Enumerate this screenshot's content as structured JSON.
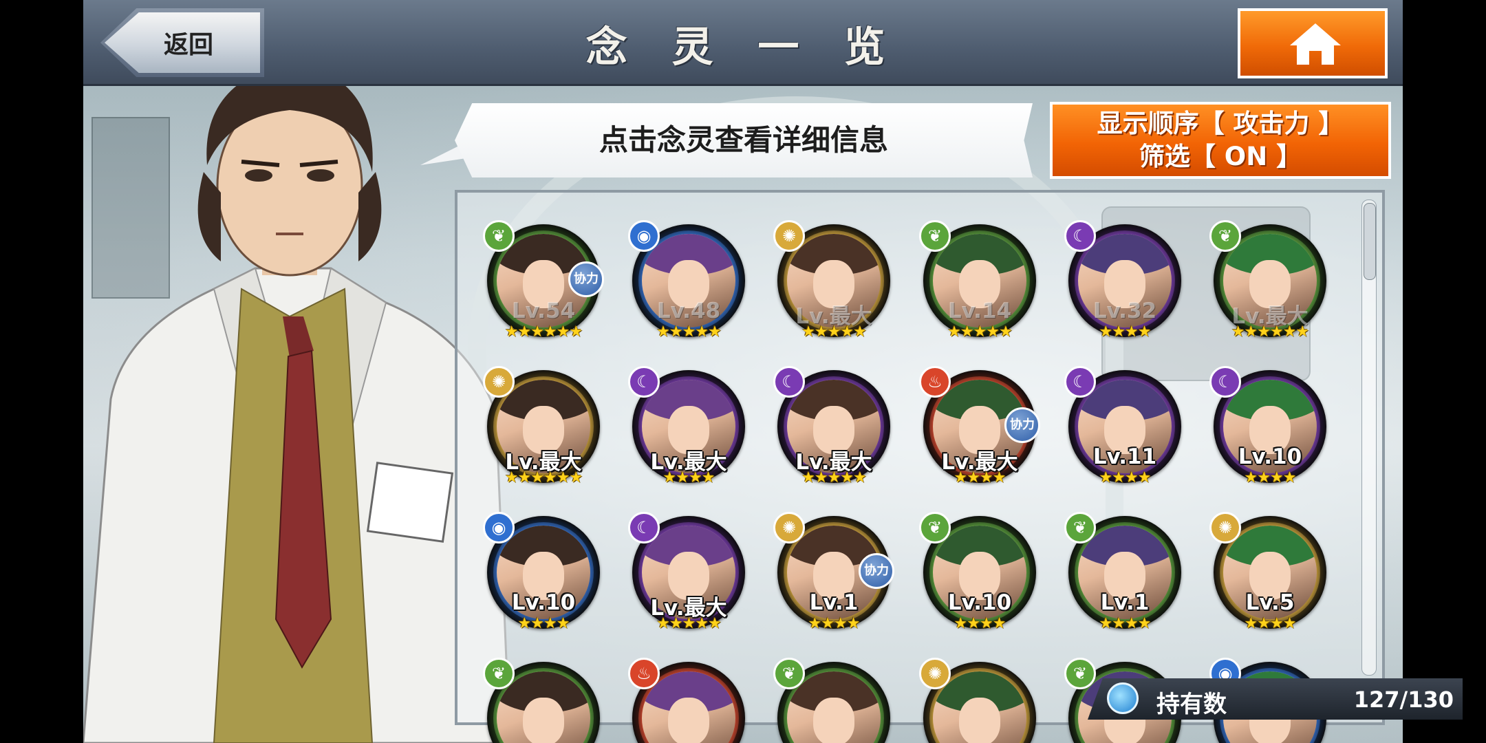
{
  "header": {
    "title": "念 灵 一 览",
    "back_label": "返回"
  },
  "hint": "点击念灵查看详细信息",
  "sort": {
    "order_label": "显示顺序【 攻击力 】",
    "filter_label": "筛选【 ON 】"
  },
  "element_icons": {
    "wood": "leaf-icon",
    "water": "water-drop-icon",
    "light": "light-burst-icon",
    "dark": "crescent-moon-icon",
    "fire": "flame-icon"
  },
  "element_colors": {
    "wood": "#5ba53b",
    "water": "#2f6fd0",
    "light": "#d8a93a",
    "dark": "#7a3bb3",
    "fire": "#d9452a"
  },
  "rows": [
    [
      {
        "element": "wood",
        "level": "Lv.54",
        "stars": "★★★★★★",
        "coop": true,
        "dim": true
      },
      {
        "element": "water",
        "level": "Lv.48",
        "stars": "★★★★★",
        "coop": false,
        "dim": true
      },
      {
        "element": "light",
        "level": "Lv.最大",
        "stars": "★★★★★",
        "coop": false,
        "dim": true
      },
      {
        "element": "wood",
        "level": "Lv.14",
        "stars": "★★★★★",
        "coop": false,
        "dim": true
      },
      {
        "element": "dark",
        "level": "Lv.32",
        "stars": "★★★★",
        "coop": false,
        "dim": true
      },
      {
        "element": "wood",
        "level": "Lv.最大",
        "stars": "★★★★★★",
        "coop": false,
        "dim": true
      }
    ],
    [
      {
        "element": "light",
        "level": "Lv.最大",
        "stars": "★★★★★★",
        "coop": false,
        "dim": false
      },
      {
        "element": "dark",
        "level": "Lv.最大",
        "stars": "★★★★",
        "coop": false,
        "dim": false
      },
      {
        "element": "dark",
        "level": "Lv.最大",
        "stars": "★★★★★",
        "coop": false,
        "dim": false
      },
      {
        "element": "fire",
        "level": "Lv.最大",
        "stars": "★★★★",
        "coop": true,
        "dim": false
      },
      {
        "element": "dark",
        "level": "Lv.11",
        "stars": "★★★★",
        "coop": false,
        "dim": false
      },
      {
        "element": "dark",
        "level": "Lv.10",
        "stars": "★★★★",
        "coop": false,
        "dim": false
      }
    ],
    [
      {
        "element": "water",
        "level": "Lv.10",
        "stars": "★★★★",
        "coop": false,
        "dim": false
      },
      {
        "element": "dark",
        "level": "Lv.最大",
        "stars": "★★★★★",
        "coop": false,
        "dim": false
      },
      {
        "element": "light",
        "level": "Lv.1",
        "stars": "★★★★",
        "coop": true,
        "dim": false
      },
      {
        "element": "wood",
        "level": "Lv.10",
        "stars": "★★★★",
        "coop": false,
        "dim": false
      },
      {
        "element": "wood",
        "level": "Lv.1",
        "stars": "★★★★",
        "coop": false,
        "dim": false
      },
      {
        "element": "light",
        "level": "Lv.5",
        "stars": "★★★★",
        "coop": false,
        "dim": false
      }
    ],
    [
      {
        "element": "wood",
        "level": "",
        "stars": "",
        "coop": false,
        "dim": false
      },
      {
        "element": "fire",
        "level": "",
        "stars": "",
        "coop": false,
        "dim": false
      },
      {
        "element": "wood",
        "level": "",
        "stars": "",
        "coop": false,
        "dim": false
      },
      {
        "element": "light",
        "level": "",
        "stars": "",
        "coop": false,
        "dim": false
      },
      {
        "element": "wood",
        "level": "",
        "stars": "",
        "coop": false,
        "dim": false
      },
      {
        "element": "water",
        "level": "",
        "stars": "",
        "coop": false,
        "dim": false
      }
    ]
  ],
  "coop_label": "协力",
  "owned": {
    "label": "持有数",
    "value": "127/130"
  },
  "home_icon": "home-icon"
}
